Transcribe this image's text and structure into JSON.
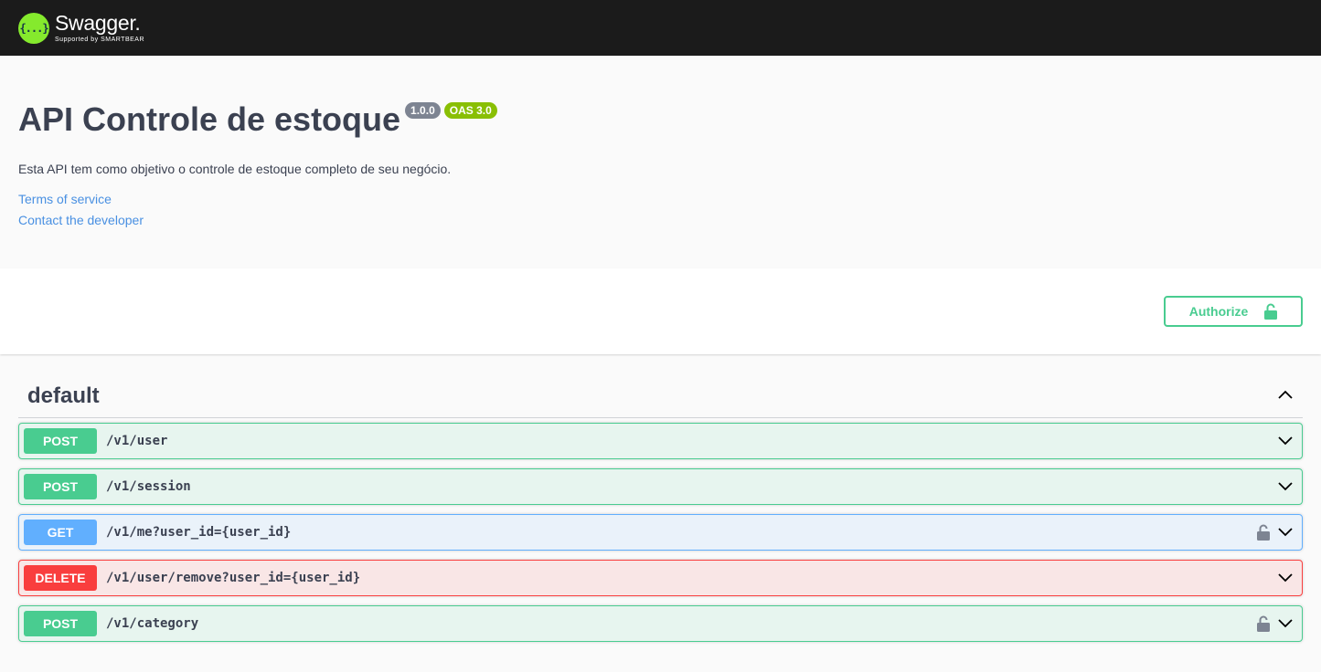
{
  "topbar": {
    "logo_glyph": "{...}",
    "brand": "Swagger.",
    "subtitle": "Supported by SMARTBEAR"
  },
  "info": {
    "title": "API Controle de estoque",
    "version": "1.0.0",
    "oas": "OAS 3.0",
    "description": "Esta API tem como objetivo o controle de estoque completo de seu negócio.",
    "terms_link": "Terms of service",
    "contact_link": "Contact the developer"
  },
  "scheme": {
    "authorize_label": "Authorize",
    "authorize_icon": "unlock-icon"
  },
  "tag": {
    "name": "default",
    "toggle_icon": "chevron-up-icon"
  },
  "operations": [
    {
      "method": "POST",
      "path": "/v1/user",
      "locked": false
    },
    {
      "method": "POST",
      "path": "/v1/session",
      "locked": false
    },
    {
      "method": "GET",
      "path": "/v1/me?user_id={user_id}",
      "locked": true
    },
    {
      "method": "DELETE",
      "path": "/v1/user/remove?user_id={user_id}",
      "locked": false
    },
    {
      "method": "POST",
      "path": "/v1/category",
      "locked": true
    }
  ],
  "colors": {
    "post": "#49cc90",
    "get": "#61affe",
    "delete": "#f93e3e",
    "brand_green": "#85ea2d",
    "link": "#4990e2"
  }
}
